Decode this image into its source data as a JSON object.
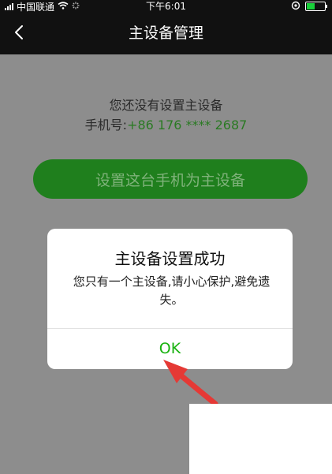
{
  "status_bar": {
    "carrier": "中国联通",
    "time": "下午6:01",
    "icons": [
      "signal-icon",
      "wifi-icon",
      "loading-icon",
      "location-icon",
      "battery-icon"
    ]
  },
  "nav": {
    "title": "主设备管理",
    "back_icon": "chevron-left-icon"
  },
  "main": {
    "notice": "您还没有设置主设备",
    "phone_label": "手机号:",
    "phone_value": "+86 176 **** 2687",
    "primary_button": "设置这台手机为主设备"
  },
  "dialog": {
    "title": "主设备设置成功",
    "message": "您只有一个主设备,请小心保护,避免遗失。",
    "ok_label": "OK"
  },
  "colors": {
    "accent_green": "#18b20f",
    "button_green": "#1f7f1d",
    "overlay_gray": "#8d8d8d",
    "arrow_red": "#e53935"
  }
}
